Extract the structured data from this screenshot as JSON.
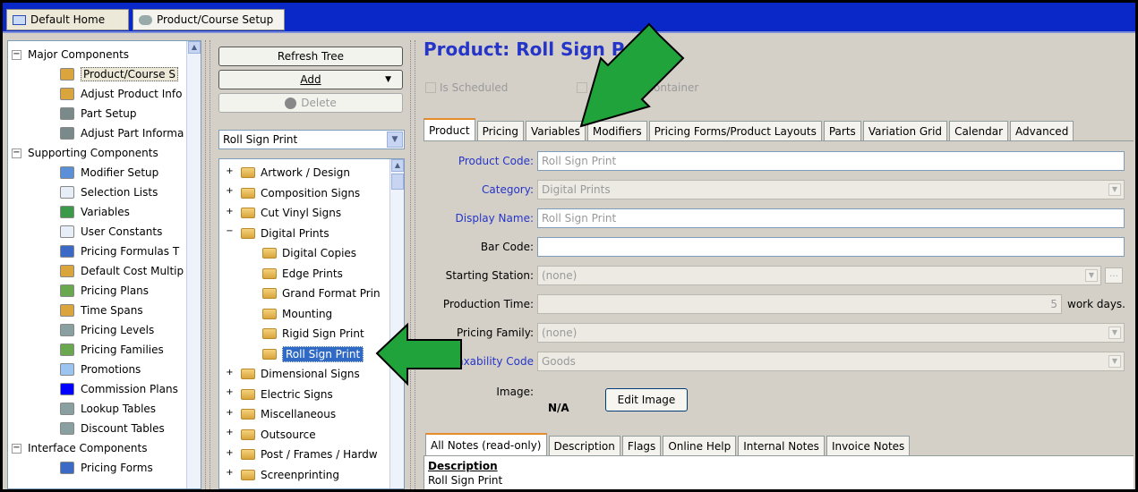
{
  "top_tabs": [
    "Default Home",
    "Product/Course Setup"
  ],
  "left_tree": {
    "groups": [
      {
        "label": "Major Components",
        "expand": "−",
        "items": [
          "Product/Course S",
          "Adjust Product Info",
          "Part Setup",
          "Adjust Part Informa"
        ]
      },
      {
        "label": "Supporting Components",
        "expand": "−",
        "items": [
          "Modifier Setup",
          "Selection Lists",
          "Variables",
          "User Constants",
          "Pricing Formulas T",
          "Default Cost Multip",
          "Pricing Plans",
          "Time Spans",
          "Pricing Levels",
          "Pricing Families",
          "Promotions",
          "Commission Plans",
          "Lookup Tables",
          "Discount Tables"
        ]
      },
      {
        "label": "Interface Components",
        "expand": "−",
        "items": [
          "Pricing Forms"
        ]
      }
    ]
  },
  "middle": {
    "refresh_label": "Refresh Tree",
    "add_label": "Add",
    "delete_label": "Delete",
    "combo_value": "Roll Sign Print",
    "tree": [
      {
        "label": "Artwork / Design",
        "expand": "+"
      },
      {
        "label": "Composition Signs",
        "expand": "+"
      },
      {
        "label": "Cut Vinyl Signs",
        "expand": "+"
      },
      {
        "label": "Digital Prints",
        "expand": "−"
      },
      {
        "label": "Digital Copies",
        "child": true
      },
      {
        "label": "Edge Prints",
        "child": true
      },
      {
        "label": "Grand Format Prin",
        "child": true
      },
      {
        "label": "Mounting",
        "child": true
      },
      {
        "label": "Rigid Sign Print",
        "child": true
      },
      {
        "label": "Roll Sign Print",
        "child": true,
        "selected": true
      },
      {
        "label": "Dimensional Signs",
        "expand": "+"
      },
      {
        "label": "Electric Signs",
        "expand": "+"
      },
      {
        "label": "Miscellaneous",
        "expand": "+"
      },
      {
        "label": "Outsource",
        "expand": "+"
      },
      {
        "label": "Post / Frames / Hardw",
        "expand": "+"
      },
      {
        "label": "Screenprinting",
        "expand": "+"
      }
    ]
  },
  "product": {
    "title": "Product:  Roll Sign Print",
    "is_scheduled": "Is Scheduled",
    "assembly": "Assembly Container",
    "tabs": [
      "Product",
      "Pricing",
      "Variables",
      "Modifiers",
      "Pricing Forms/Product Layouts",
      "Parts",
      "Variation Grid",
      "Calendar",
      "Advanced"
    ],
    "labels": {
      "product_code": "Product Code:",
      "category": "Category:",
      "display_name": "Display Name:",
      "bar_code": "Bar Code:",
      "starting_station": "Starting Station:",
      "production_time": "Production Time:",
      "pricing_family": "Pricing Family:",
      "taxability_code": "Taxability Code",
      "image": "Image:"
    },
    "values": {
      "product_code": "Roll Sign Print",
      "category": "Digital Prints",
      "display_name": "Roll Sign Print",
      "bar_code": "",
      "starting_station": "(none)",
      "production_time": "5",
      "work_days": "work days.",
      "pricing_family": "(none)",
      "taxability_code": "Goods",
      "image": "N/A"
    },
    "edit_image": "Edit Image",
    "notes_tabs": [
      "All Notes (read-only)",
      "Description",
      "Flags",
      "Online Help",
      "Internal Notes",
      "Invoice Notes"
    ],
    "notes_heading": "Description",
    "notes_text": "Roll Sign Print"
  },
  "colors": {
    "title_blue": "#2535c8",
    "tab_bar": "#0a27c8",
    "arrow_green": "#1fa33a"
  }
}
